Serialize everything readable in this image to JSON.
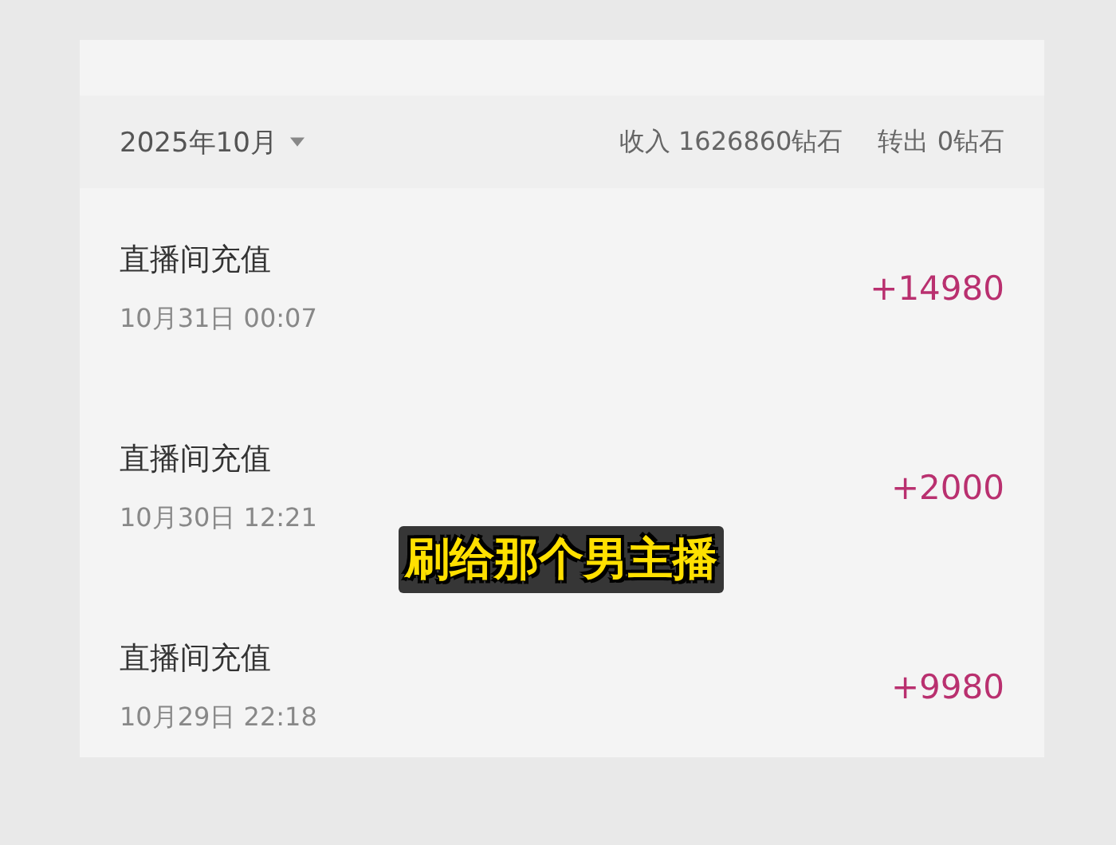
{
  "header": {
    "month": "2025年10月",
    "income": "收入 1626860钻石",
    "outgoing": "转出 0钻石"
  },
  "records": [
    {
      "title": "直播间充值",
      "time": "10月31日 00:07",
      "amount": "+14980"
    },
    {
      "title": "直播间充值",
      "time": "10月30日 12:21",
      "amount": "+2000"
    },
    {
      "title": "直播间充值",
      "time": "10月29日 22:18",
      "amount": "+9980"
    }
  ],
  "subtitle": "刷给那个男主播"
}
